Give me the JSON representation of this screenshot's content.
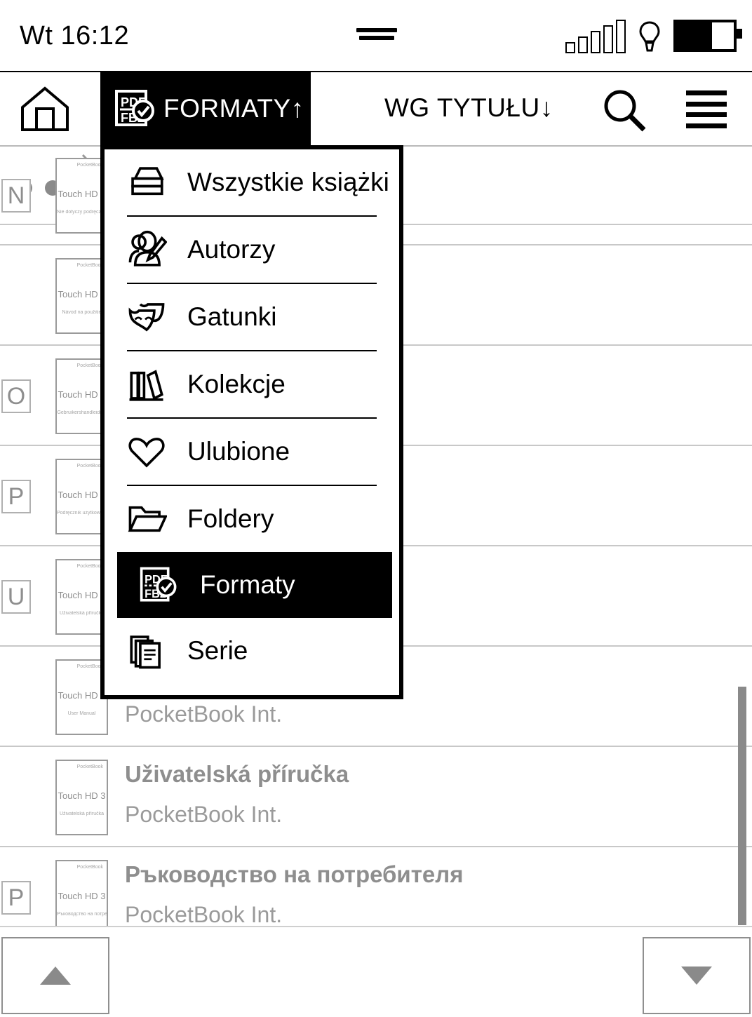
{
  "statusbar": {
    "clock": "Wt 16:12",
    "signal_icon": "signal-bars-icon",
    "frontlight_icon": "lightbulb-icon",
    "battery_icon": "battery-icon",
    "battery_level_percent": 62
  },
  "toolbar": {
    "home_icon": "home-icon",
    "filter_label": "FORMATY↑",
    "filter_icon": "pdf-fb2-check-icon",
    "sort_label": "WG TYTUŁU↓",
    "search_icon": "search-icon",
    "menu_icon": "hamburger-menu-icon"
  },
  "breadcrumb": {
    "ellipsis": "•••",
    "chevron_icon": "chevron-right-icon"
  },
  "dropdown": {
    "selected": "Formaty",
    "items": [
      {
        "label": "Wszystkie książki",
        "icon": "books-stack-icon",
        "selected": false
      },
      {
        "label": "Autorzy",
        "icon": "author-pencil-icon",
        "selected": false
      },
      {
        "label": "Gatunki",
        "icon": "theater-mask-icon",
        "selected": false
      },
      {
        "label": "Kolekcje",
        "icon": "bookshelf-icon",
        "selected": false
      },
      {
        "label": "Ulubione",
        "icon": "heart-icon",
        "selected": false
      },
      {
        "label": "Foldery",
        "icon": "folder-icon",
        "selected": false
      },
      {
        "label": "Formaty",
        "icon": "pdf-fb2-check-icon",
        "selected": true
      },
      {
        "label": "Serie",
        "icon": "documents-stack-icon",
        "selected": false
      }
    ]
  },
  "library": {
    "cover": {
      "brand": "PocketBook",
      "model": "Touch HD 3"
    },
    "rows": [
      {
        "letter": "N",
        "title": "",
        "author": "",
        "cover_sub": "Nie dotyczy podręcznika"
      },
      {
        "letter": "",
        "title": "",
        "author": "",
        "cover_sub": "Návod na použitie"
      },
      {
        "letter": "O",
        "title": "",
        "author": "",
        "cover_sub": "Gebruikershandleiding"
      },
      {
        "letter": "P",
        "title": "",
        "author": "",
        "cover_sub": "Podręcznik użytkownika"
      },
      {
        "letter": "U",
        "title": "",
        "author": "",
        "cover_sub": "Uživatelská příručka"
      },
      {
        "letter": "",
        "title": "",
        "author": "PocketBook Int.",
        "cover_sub": "User Manual"
      },
      {
        "letter": "",
        "title": "Uživatelská příručka",
        "author": "PocketBook Int.",
        "cover_sub": "Uživatelská příručka"
      },
      {
        "letter": "P",
        "title": "Ръководство на потребителя",
        "author": "PocketBook Int.",
        "cover_sub": "Ръководство на потребителя"
      }
    ]
  },
  "bottom_nav": {
    "prev_icon": "triangle-up-icon",
    "next_icon": "triangle-down-icon"
  },
  "colors": {
    "accent": "#000000",
    "text_muted": "#8e8e8e",
    "divider": "#c8c8c8"
  }
}
